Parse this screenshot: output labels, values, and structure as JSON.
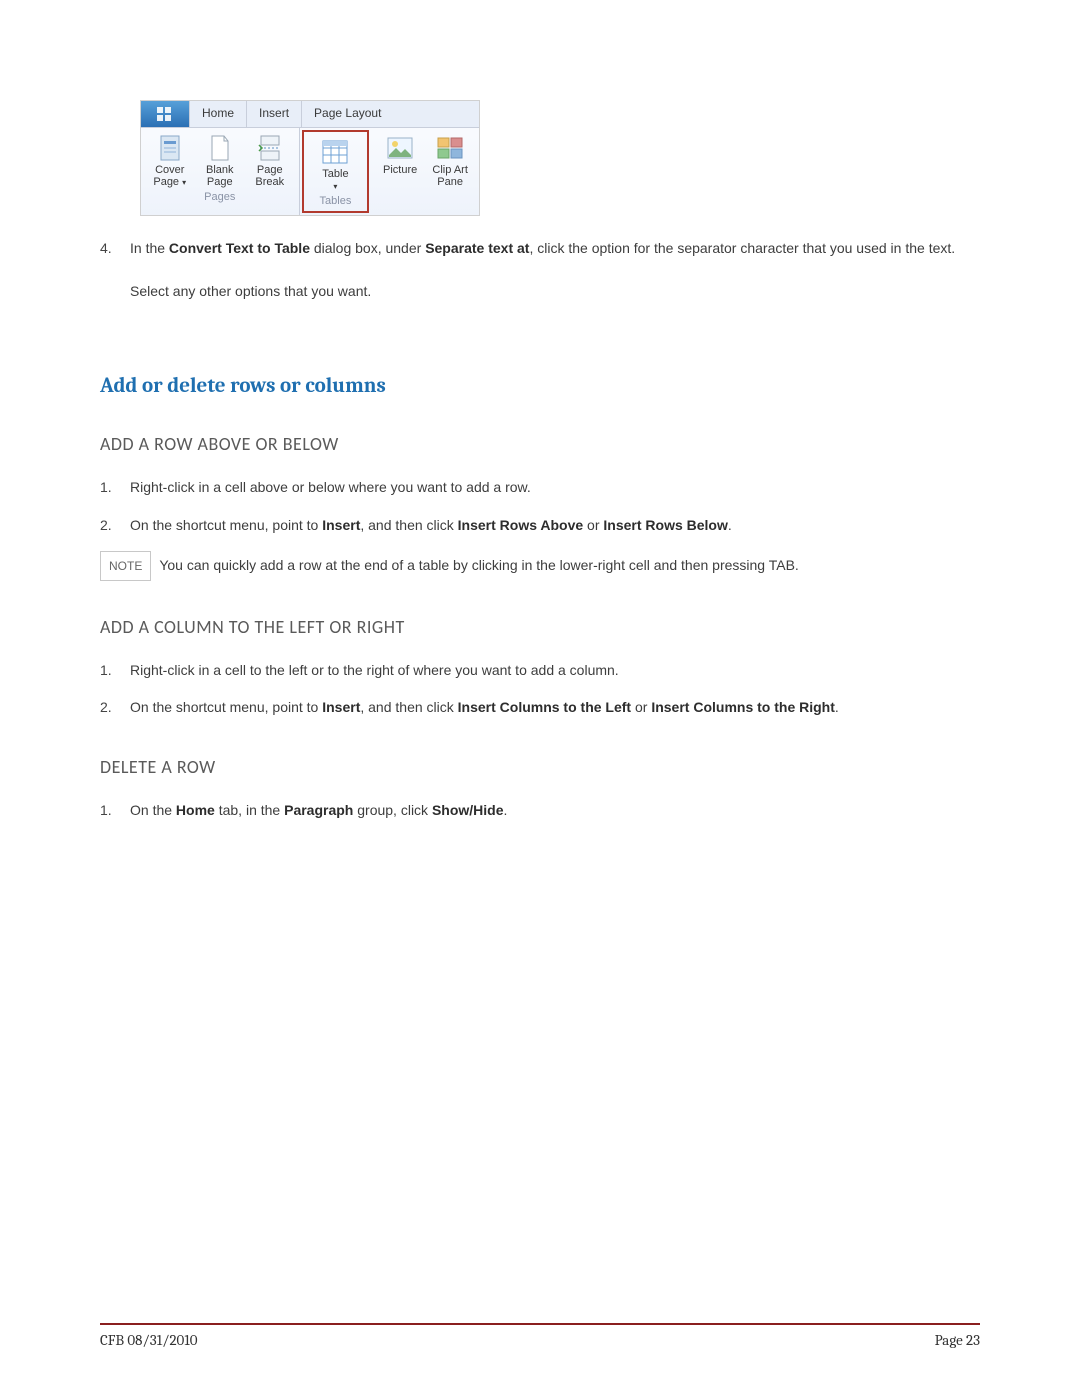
{
  "ribbon": {
    "tabs": {
      "home": "Home",
      "insert": "Insert",
      "pagelayout": "Page Layout"
    },
    "pages": {
      "group_label": "Pages",
      "cover": "Cover Page",
      "blank": "Blank Page",
      "break": "Page Break"
    },
    "tables": {
      "group_label": "Tables",
      "table": "Table"
    },
    "illus": {
      "picture": "Picture",
      "clipart": "Clip Art Pane"
    }
  },
  "step4": {
    "num": "4.",
    "text_pre": "In the ",
    "bold1": "Convert Text to Table",
    "text_mid1": " dialog box, under ",
    "bold2": "Separate text at",
    "text_post": ", click the option for the separator character that you used in the text.",
    "followup": "Select any other options that you want."
  },
  "heading_main": "Add or delete rows or columns",
  "sectionA": {
    "heading": "ADD A ROW ABOVE OR BELOW",
    "step1": {
      "num": "1.",
      "text": "Right-click in a cell above or below where you want to add a row."
    },
    "step2": {
      "num": "2.",
      "pre": "On the shortcut menu, point to ",
      "b1": "Insert",
      "mid1": ", and then click ",
      "b2": "Insert Rows Above",
      "mid2": " or ",
      "b3": "Insert Rows Below",
      "post": "."
    },
    "note_label": "NOTE",
    "note_text": "You can quickly add a row at the end of a table by clicking in the lower-right cell and then pressing TAB."
  },
  "sectionB": {
    "heading": "ADD A COLUMN TO THE LEFT OR RIGHT",
    "step1": {
      "num": "1.",
      "text": "Right-click in a cell to the left or to the right of where you want to add a column."
    },
    "step2": {
      "num": "2.",
      "pre": "On the shortcut menu, point to ",
      "b1": "Insert",
      "mid1": ", and then click ",
      "b2": "Insert Columns to the Left",
      "mid2": " or ",
      "b3": "Insert Columns to the Right",
      "post": "."
    }
  },
  "sectionC": {
    "heading": "DELETE A ROW",
    "step1": {
      "num": "1.",
      "pre": "On the ",
      "b1": "Home",
      "mid1": " tab, in the ",
      "b2": "Paragraph",
      "mid2": " group, click ",
      "b3": "Show/Hide",
      "post": "."
    }
  },
  "footer": {
    "left": "CFB 08/31/2010",
    "right": "Page 23"
  }
}
